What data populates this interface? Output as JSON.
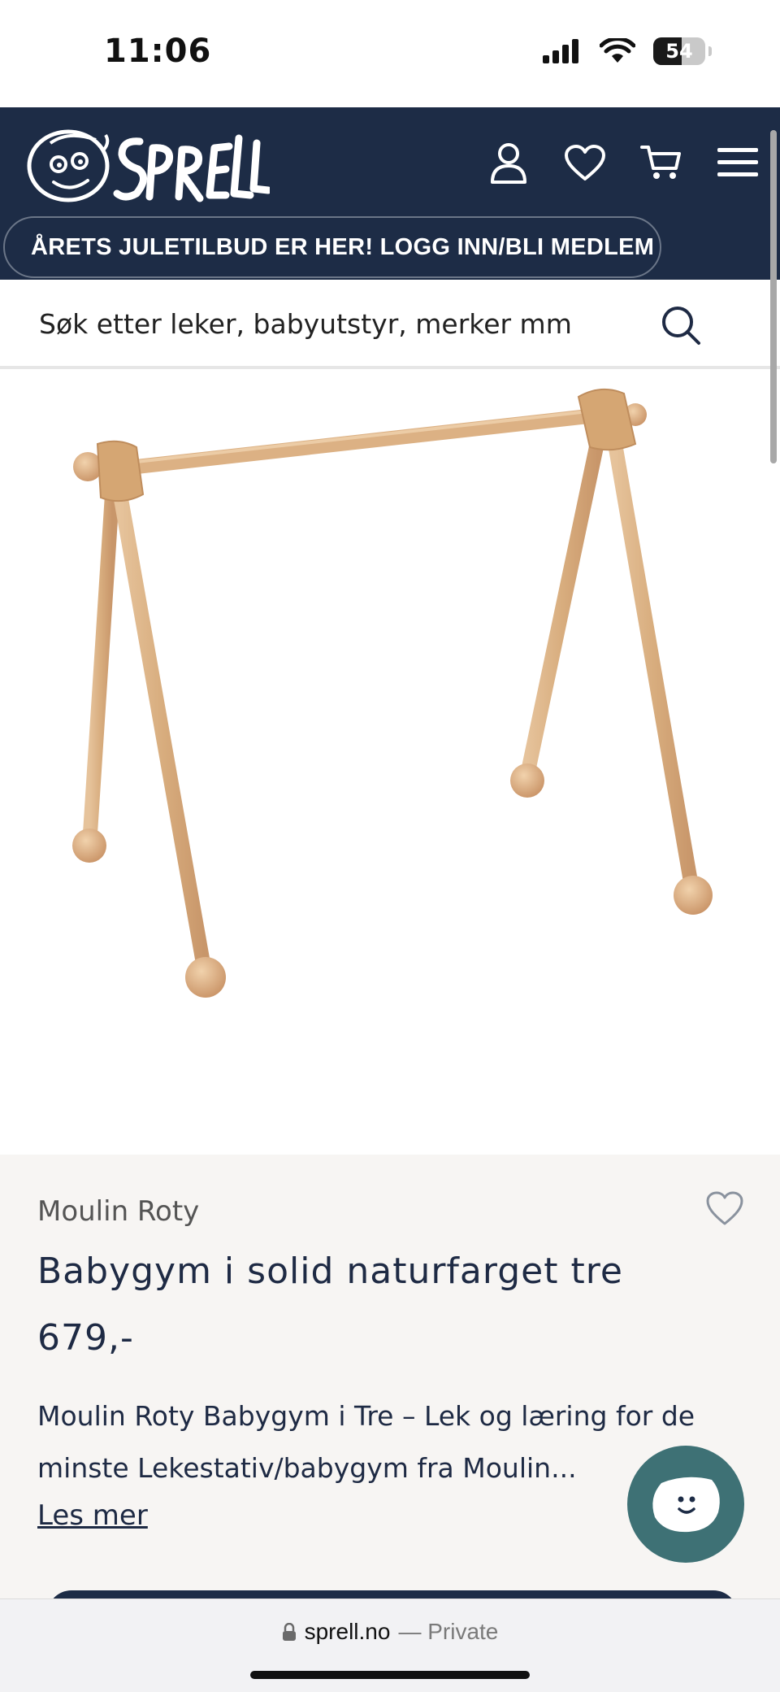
{
  "status_bar": {
    "time": "11:06",
    "battery": "54",
    "battery_level": 0.54
  },
  "header": {
    "logo_text": "SPRELL",
    "icons": [
      "user-icon",
      "heart-icon",
      "cart-icon",
      "menu-icon"
    ],
    "promo": "ÅRETS JULETILBUD ER HER! LOGG INN/BLI MEDLEM",
    "colors": {
      "background": "#1d2c46",
      "text": "#ffffff"
    }
  },
  "search": {
    "placeholder": "Søk etter leker, babyutstyr, merker mm",
    "value": ""
  },
  "product": {
    "brand": "Moulin Roty",
    "title": "Babygym i solid naturfarget tre",
    "price": "679,-",
    "description": "Moulin Roty Babygym i Tre – Lek og læring for de minste Lekestativ/babygym fra Moulin...",
    "read_more": "Les mer",
    "image_icon": "wooden-baby-gym"
  },
  "chat": {
    "icon": "smiley-chat-icon",
    "color": "#3e7175"
  },
  "url_bar": {
    "domain": "sprell.no",
    "mode": "— Private"
  }
}
